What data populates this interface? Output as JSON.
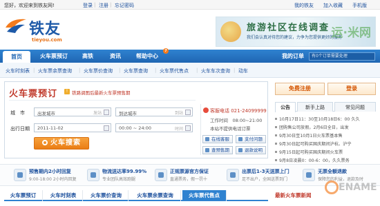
{
  "topbar": {
    "greeting": "您好，欢迎来到铁友网!",
    "login": "登录",
    "register": "注册",
    "forgot": "忘记密码",
    "my_tieyou": "我的铁友",
    "favorite": "加入收藏",
    "mobile": "手机版"
  },
  "logo": {
    "name": "铁友",
    "domain": "tieyou.com"
  },
  "banner": {
    "title": "旅游社区在线调查",
    "subtitle": "我们会认真对待您的建议，力争为您提供更好的服务",
    "watermark": "运·米网"
  },
  "nav": {
    "items": [
      "首页",
      "火车票预订",
      "高铁",
      "资讯",
      "帮助中心"
    ],
    "badge": "7",
    "orders_label": "我的订单",
    "orders_value": "有0个订单需要处理"
  },
  "subnav": [
    "火车时刻表",
    "火车票余票查询",
    "火车票价查询",
    "火车票查询",
    "火车票代售点",
    "火车车次查询",
    "动车"
  ],
  "search": {
    "title": "火车票预订",
    "note_icon": "!",
    "note": "铁路调图后最新火车票预售期",
    "city_label": "城　市",
    "from_placeholder": "出发城市",
    "from_hint": "发站",
    "to_placeholder": "到达城市",
    "to_hint": "到站",
    "date_label": "出行日期",
    "date_value": "2011-11-02",
    "time_value": "00:00 ~ 24:00",
    "time_hint": "时间",
    "button": "火车搜索"
  },
  "service": {
    "phone": "客服电话 021-24099999",
    "hours": "工作时间　08:00~21:00",
    "notice": "本站不提供电话订票",
    "buttons": [
      "在线客服",
      "支付问题",
      "查预售期",
      "退款说明"
    ]
  },
  "account": {
    "register": "免费注册",
    "login": "登录"
  },
  "right_tabs": [
    "公告",
    "新手上路",
    "常见问题"
  ],
  "notices": [
    "10月17日11：30至10月18日6：00 久久",
    "团购售公司放假，2月6日全日，出发",
    "9月30日至10月1日火车票基本售",
    "9月30日起可购买国庆期间沪杭、沪宁",
    "9月15日起可购买国庆期间火车票",
    "9月8日凌晨0：00-6：00，久久票务"
  ],
  "features": [
    {
      "title": "预售期内2小时回复",
      "desc": "9:00-18:00 2小时内回复"
    },
    {
      "title": "物流送达率99.99%",
      "desc": "专业团队高效跑腿"
    },
    {
      "title": "正规票源官方保证",
      "desc": "直通票务，假一罚十"
    },
    {
      "title": "出票后1-3天送票上门",
      "desc": "足不出户，全国送票到门"
    },
    {
      "title": "无票全额退款",
      "desc": "保障您的利益，退款及时"
    }
  ],
  "bottom_tabs": [
    "火车票预订",
    "火车时刻表",
    "火车票价查询",
    "火车票余票查询",
    "火车票代售点"
  ],
  "news_title": "最新火车票新闻",
  "watermark2": "ENAME"
}
